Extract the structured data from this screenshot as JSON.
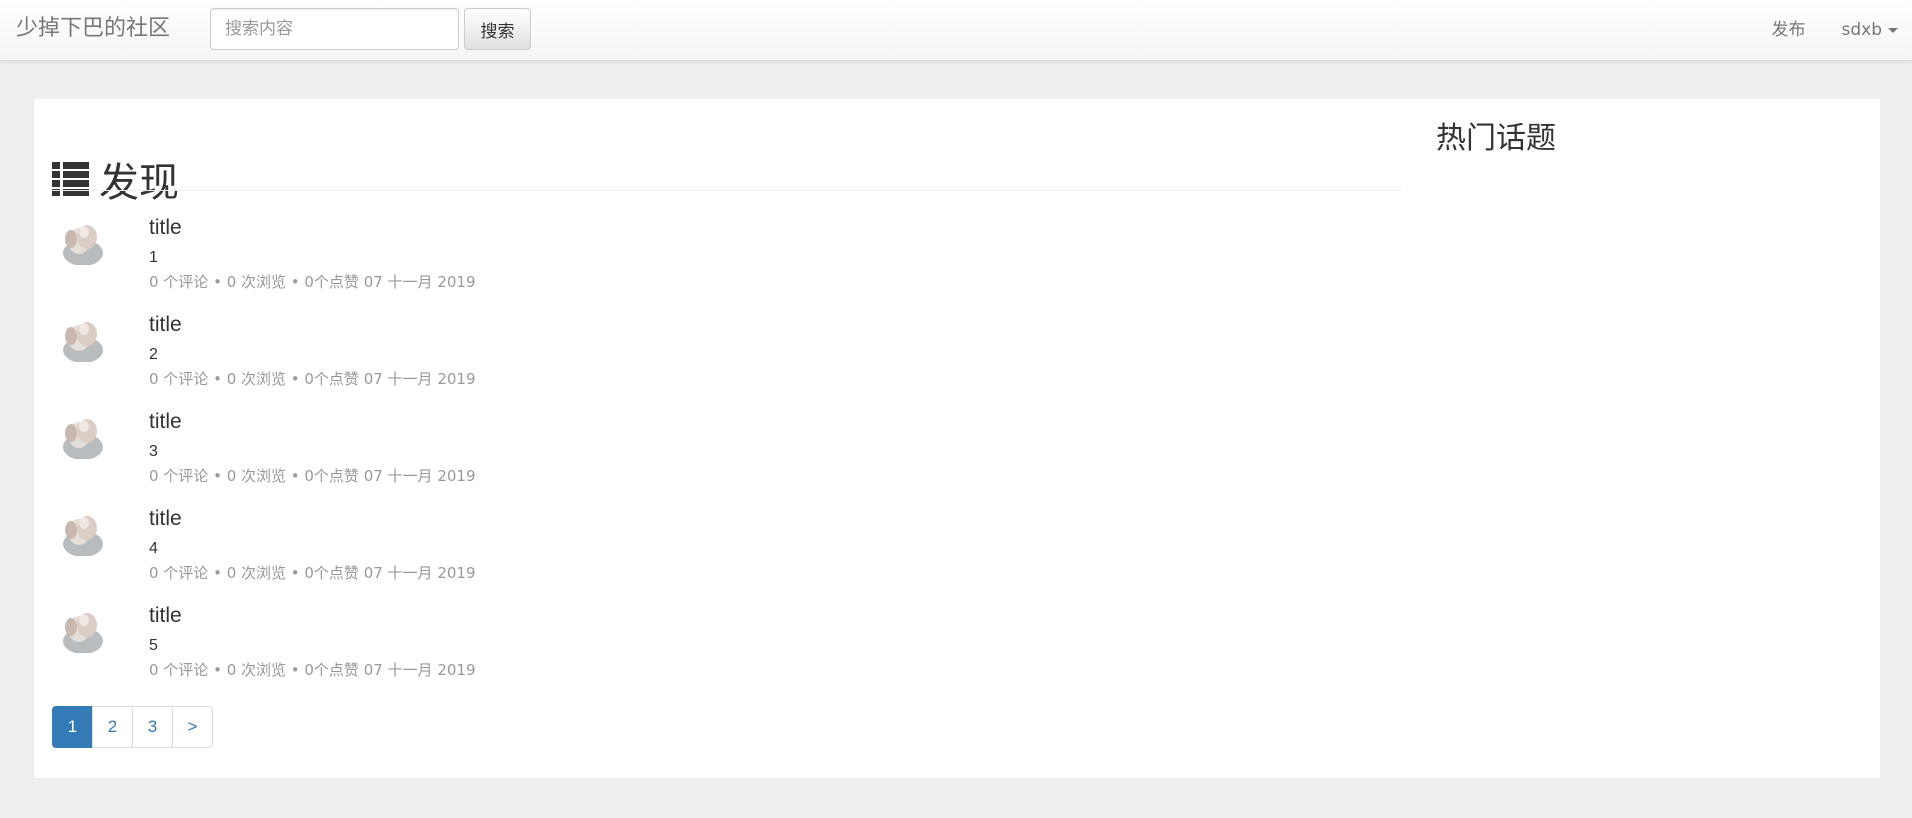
{
  "navbar": {
    "brand": "少掉下巴的社区",
    "search_placeholder": "搜索内容",
    "search_button": "搜索",
    "publish_link": "发布",
    "username": "sdxb"
  },
  "main": {
    "title": "发现",
    "questions": [
      {
        "title": "title",
        "description": "1",
        "meta": "0 个评论 • 0 次浏览 • 0个点赞 07 十一月 2019"
      },
      {
        "title": "title",
        "description": "2",
        "meta": "0 个评论 • 0 次浏览 • 0个点赞 07 十一月 2019"
      },
      {
        "title": "title",
        "description": "3",
        "meta": "0 个评论 • 0 次浏览 • 0个点赞 07 十一月 2019"
      },
      {
        "title": "title",
        "description": "4",
        "meta": "0 个评论 • 0 次浏览 • 0个点赞 07 十一月 2019"
      },
      {
        "title": "title",
        "description": "5",
        "meta": "0 个评论 • 0 次浏览 • 0个点赞 07 十一月 2019"
      }
    ],
    "pagination": [
      "1",
      "2",
      "3",
      ">"
    ],
    "current_page": "1"
  },
  "sidebar": {
    "hot_topics_title": "热门话题"
  },
  "colors": {
    "page_bg": "#eeeeee",
    "link_blue": "#337ab7",
    "meta_gray": "#999999",
    "nav_text": "#777777"
  },
  "icons": {
    "title_icon": "list-icon",
    "user_menu_icon": "caret-down-icon",
    "avatar": "user-avatar"
  }
}
